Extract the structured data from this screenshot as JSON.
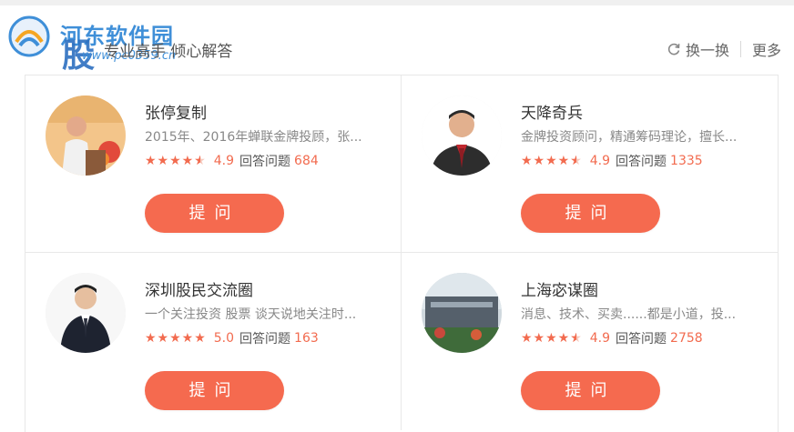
{
  "watermark": {
    "title": "河东软件园",
    "url": "www.pc0359.cn",
    "brand_char": "股"
  },
  "header": {
    "subtitle": "专业高手 倾心解答",
    "refresh_label": "换一换",
    "more_label": "更多"
  },
  "accent_color": "#f56a4f",
  "advisors": [
    {
      "name": "张停复制",
      "description": "2015年、2016年蝉联金牌投顾，张...",
      "stars": "★★★★",
      "rating": "4.9",
      "answers_label": "回答问题",
      "answers_count": "684",
      "ask_label": "提问"
    },
    {
      "name": "天降奇兵",
      "description": "金牌投资顾问，精通筹码理论，擅长...",
      "stars": "★★★★",
      "rating": "4.9",
      "answers_label": "回答问题",
      "answers_count": "1335",
      "ask_label": "提问"
    },
    {
      "name": "深圳股民交流圈",
      "description": "一个关注投资 股票 谈天说地关注时...",
      "stars": "★★★★★",
      "rating": "5.0",
      "answers_label": "回答问题",
      "answers_count": "163",
      "ask_label": "提问"
    },
    {
      "name": "上海宓谋圈",
      "description": "消息、技术、买卖......都是小道，投...",
      "stars": "★★★★",
      "rating": "4.9",
      "answers_label": "回答问题",
      "answers_count": "2758",
      "ask_label": "提问"
    }
  ]
}
